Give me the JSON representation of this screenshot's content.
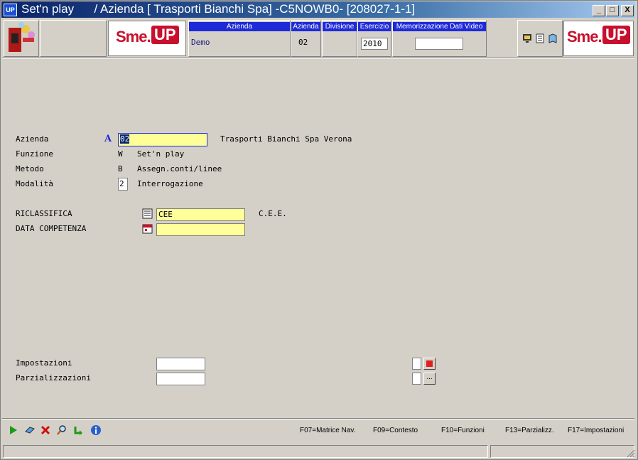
{
  "titlebar": {
    "app_icon": "UP",
    "title": "Set'n play      / Azienda [ Trasporti Bianchi Spa] -C5NOWB0- [208027-1-1]",
    "minimize": "_",
    "maximize": "□",
    "close": "X"
  },
  "header": {
    "azienda_col": {
      "label": "Azienda",
      "value": "Demo"
    },
    "azienda_code_col": {
      "label": "Azienda",
      "value": "02"
    },
    "divisione_col": {
      "label": "Divisione",
      "value": ""
    },
    "esercizio_col": {
      "label": "Esercizio",
      "value": "2010"
    },
    "memorizzazione_col": {
      "label": "Memorizzazione Dati Video",
      "value": ""
    },
    "logo_left": {
      "sme": "Sme.",
      "up": "UP"
    },
    "logo_right": {
      "sme": "Sme.",
      "up": "UP"
    }
  },
  "form": {
    "azienda_label": "Azienda",
    "azienda_value": "02",
    "azienda_desc": "Trasporti Bianchi Spa Verona",
    "funzione_label": "Funzione",
    "funzione_code": "W",
    "funzione_desc": "Set'n play",
    "metodo_label": "Metodo",
    "metodo_code": "B",
    "metodo_desc": "Assegn.conti/linee",
    "modalita_label": "Modalità",
    "modalita_value": "2",
    "modalita_desc": "Interrogazione",
    "riclassifica_label": "RICLASSIFICA",
    "riclassifica_value": "CEE",
    "riclassifica_desc": "C.E.E.",
    "data_label": "DATA COMPETENZA",
    "data_value": "",
    "impostazioni_label": "Impostazioni",
    "impostazioni_value": "",
    "parzializzazioni_label": "Parzializzazioni",
    "parzializzazioni_value": "",
    "parz_button": "..."
  },
  "fkeys": {
    "f07": "F07=Matrice Nav.",
    "f09": "F09=Contesto",
    "f10": "F10=Funzioni",
    "f13": "F13=Parzializz.",
    "f17": "F17=Impostazioni"
  },
  "colors": {
    "field_yellow": "#ffff99",
    "brand_red": "#c8102e",
    "title_blue": "#0a246a",
    "header_blue": "#1e2ad8"
  }
}
